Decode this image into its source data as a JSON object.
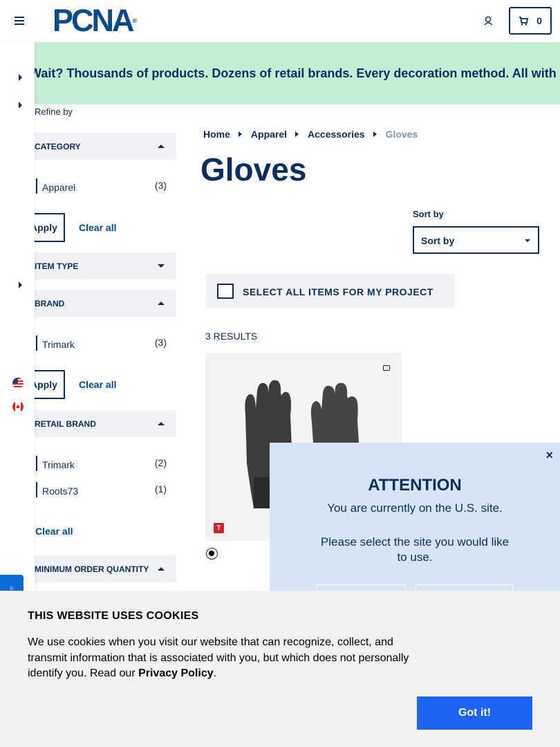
{
  "header": {
    "logo_text": "PCNA",
    "logo_tm": "®",
    "cart_count": "0"
  },
  "banner": {
    "text": "Why Wait? Thousands of products. Dozens of retail brands. Every decoration method. All with a standard lead time of just five business days."
  },
  "sidebar": {
    "refine_label": "Refine by",
    "facets": [
      {
        "title": "Category",
        "expanded": true,
        "options": [
          {
            "label": "Apparel",
            "count": "(3)"
          }
        ],
        "apply_label": "Apply",
        "clear_label": "Clear all"
      },
      {
        "title": "Item Type",
        "expanded": false
      },
      {
        "title": "Brand",
        "expanded": true,
        "options": [
          {
            "label": "Trimark",
            "count": "(3)"
          }
        ],
        "apply_label": "Apply",
        "clear_label": "Clear all"
      },
      {
        "title": "Retail Brand",
        "expanded": true,
        "options": [
          {
            "label": "Trimark",
            "count": "(2)"
          },
          {
            "label": "Roots73",
            "count": "(1)"
          }
        ],
        "clear_label": "Clear all"
      },
      {
        "title": "Minimum Order Quantity",
        "expanded": true
      }
    ]
  },
  "breadcrumb": [
    "Home",
    "Apparel",
    "Accessories",
    "Gloves"
  ],
  "main": {
    "title": "Gloves",
    "sort_label": "Sort by",
    "sort_value": "Sort by",
    "select_all_label": "SELECT ALL ITEMS FOR MY PROJECT",
    "results_count": "3 RESULTS"
  },
  "product": {
    "brand_badge": "T",
    "swatch_color": "#000000"
  },
  "modal": {
    "close": "×",
    "title": "ATTENTION",
    "message1": "You are currently on the U.S. site.",
    "message2": "Please select the site you would like to use."
  },
  "cookie": {
    "title": "THIS WEBSITE USES COOKIES",
    "text": "We use cookies when you visit our website that can recognize, collect, and transmit information that is associated with you, but which does not personally identify you. Read our ",
    "link": "Privacy Policy",
    "period": ".",
    "button": "Got it!"
  },
  "colors": {
    "navy": "#0c2d5e",
    "banner_bg": "#c4eed4",
    "modal_bg": "#d6e4f6",
    "button_blue": "#1f64f0"
  }
}
